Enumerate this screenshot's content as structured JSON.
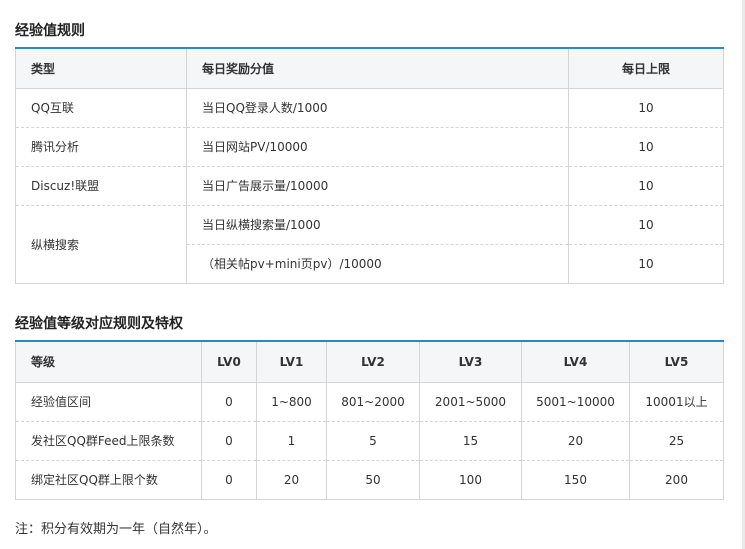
{
  "section1": {
    "title": "经验值规则",
    "headers": [
      "类型",
      "每日奖励分值",
      "每日上限"
    ],
    "rows": [
      {
        "type": "QQ互联",
        "reward": "当日QQ登录人数/1000",
        "limit": "10"
      },
      {
        "type": "腾讯分析",
        "reward": "当日网站PV/10000",
        "limit": "10"
      },
      {
        "type": "Discuz!联盟",
        "reward": "当日广告展示量/10000",
        "limit": "10"
      }
    ],
    "merged": {
      "type": "纵横搜索",
      "rows": [
        {
          "reward": "当日纵横搜索量/1000",
          "limit": "10"
        },
        {
          "reward": "（相关帖pv+mini页pv）/10000",
          "limit": "10"
        }
      ]
    }
  },
  "section2": {
    "title": "经验值等级对应规则及特权",
    "headers": [
      "等级",
      "LV0",
      "LV1",
      "LV2",
      "LV3",
      "LV4",
      "LV5"
    ],
    "rows": [
      {
        "label": "经验值区间",
        "values": [
          "0",
          "1~800",
          "801~2000",
          "2001~5000",
          "5001~10000",
          "10001以上"
        ]
      },
      {
        "label": "发社区QQ群Feed上限条数",
        "values": [
          "0",
          "1",
          "5",
          "15",
          "20",
          "25"
        ]
      },
      {
        "label": "绑定社区QQ群上限个数",
        "values": [
          "0",
          "20",
          "50",
          "100",
          "150",
          "200"
        ]
      }
    ]
  },
  "note": "注：积分有效期为一年（自然年）。",
  "colors": {
    "accent_border": "#2b88c6",
    "header_bg": "#f4f6f8",
    "grid": "#d5d5d5"
  }
}
